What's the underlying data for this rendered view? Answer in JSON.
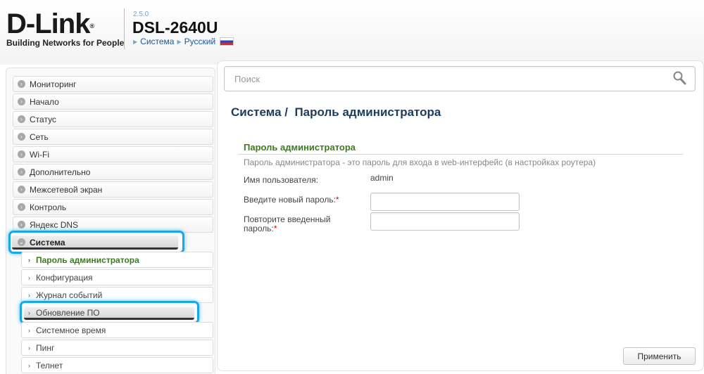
{
  "header": {
    "logo": "D-Link",
    "logo_reg": "®",
    "tagline": "Building Networks for People",
    "version": "2.5.0",
    "model": "DSL-2640U",
    "breadcrumb": [
      "Система",
      "Русский"
    ]
  },
  "search": {
    "placeholder": "Поиск"
  },
  "nav": {
    "items": [
      {
        "label": "Мониторинг"
      },
      {
        "label": "Начало"
      },
      {
        "label": "Статус"
      },
      {
        "label": "Сеть"
      },
      {
        "label": "Wi-Fi"
      },
      {
        "label": "Дополнительно"
      },
      {
        "label": "Межсетевой экран"
      },
      {
        "label": "Контроль"
      },
      {
        "label": "Яндекс DNS"
      },
      {
        "label": "Система",
        "expanded": true
      }
    ],
    "sub_items": [
      {
        "label": "Пароль администратора",
        "active": true
      },
      {
        "label": "Конфигурация"
      },
      {
        "label": "Журнал событий"
      },
      {
        "label": "Обновление ПО"
      },
      {
        "label": "Системное время"
      },
      {
        "label": "Пинг"
      },
      {
        "label": "Телнет"
      }
    ]
  },
  "main": {
    "title_section": "Система /",
    "title_page": "Пароль администратора",
    "section_title": "Пароль администратора",
    "section_desc": "Пароль администратора - это пароль для входа в web-интерфейс (в настройках роутера)",
    "username_label": "Имя пользователя:",
    "username_value": "admin",
    "new_password_label": "Введите новый пароль:",
    "repeat_password_label_1": "Повторите введенный",
    "repeat_password_label_2": "пароль:",
    "required_mark": "*",
    "new_password_value": "",
    "repeat_password_value": "",
    "apply_label": "Применить"
  },
  "colors": {
    "accent_green": "#3c7a1d",
    "title_blue": "#1d3b5c",
    "highlight": "#18a8e8"
  }
}
